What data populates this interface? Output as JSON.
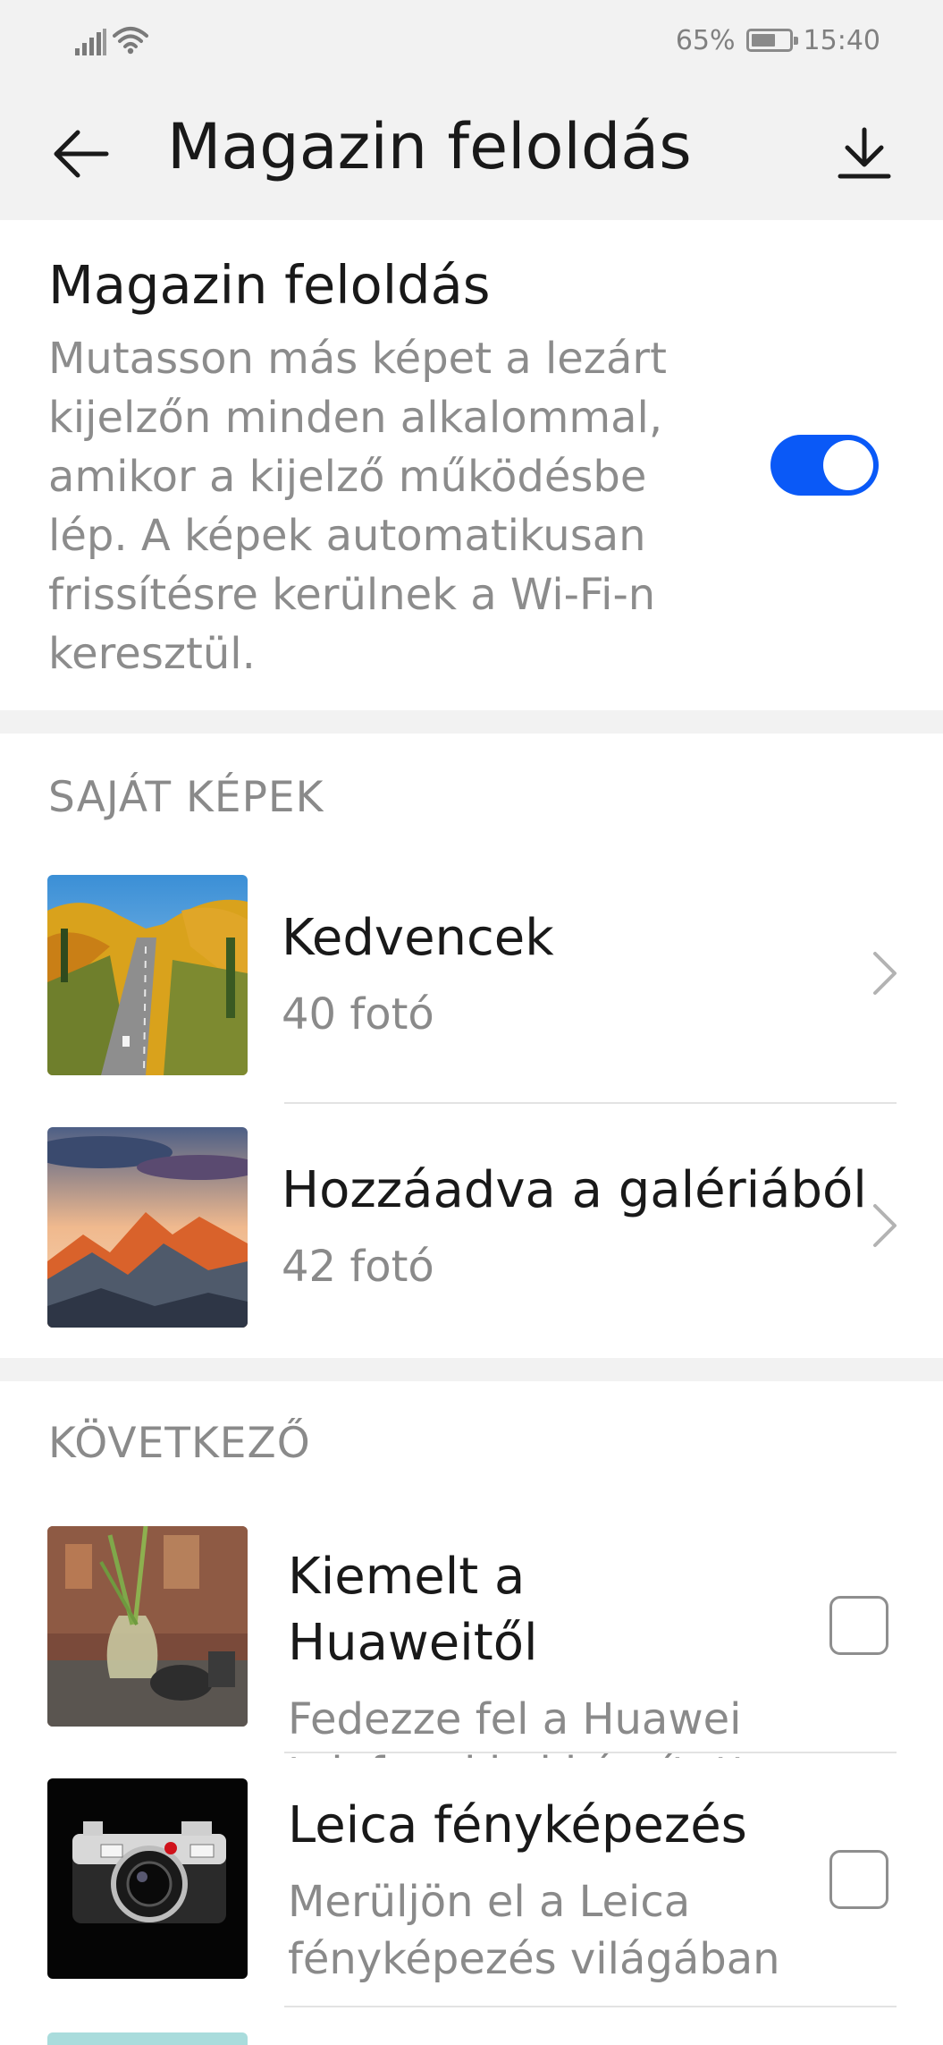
{
  "status_bar": {
    "battery_percent": "65%",
    "battery_level": 0.65,
    "time": "15:40",
    "icons": [
      "signal-icon",
      "wifi-icon",
      "battery-icon"
    ]
  },
  "app_bar": {
    "title": "Magazin feloldás",
    "back_icon": "arrow-left-icon",
    "download_icon": "download-icon"
  },
  "magazine_toggle": {
    "title": "Magazin feloldás",
    "description": "Mutasson más képet a lezárt kijelzőn minden alkalommal, amikor a kijelző működésbe lép. A képek automatikusan frissítésre kerülnek a Wi-Fi-n keresztül.",
    "enabled": true,
    "accent_color": "#0a59f7"
  },
  "own_images": {
    "header": "SAJÁT KÉPEK",
    "items": [
      {
        "title": "Kedvencek",
        "subtitle": "40 fotó",
        "thumbnail": "autumn-road-thumbnail"
      },
      {
        "title": "Hozzáadva a galériából",
        "subtitle": "42 fotó",
        "thumbnail": "mountain-sunset-thumbnail"
      }
    ]
  },
  "following": {
    "header": "KÖVETKEZŐ",
    "items": [
      {
        "title": "Kiemelt a Huaweitől",
        "title_lines": [
          "Kiemelt a",
          "Huaweitől"
        ],
        "description_lines": [
          "Fedezze fel a Huawei",
          "telefonokkal készített"
        ],
        "checked": false,
        "thumbnail": "plant-vase-thumbnail"
      },
      {
        "title": "Leica fényképezés",
        "description_lines": [
          "Merüljön el a Leica",
          "fényképezés világában"
        ],
        "checked": false,
        "thumbnail": "leica-camera-thumbnail"
      }
    ]
  }
}
